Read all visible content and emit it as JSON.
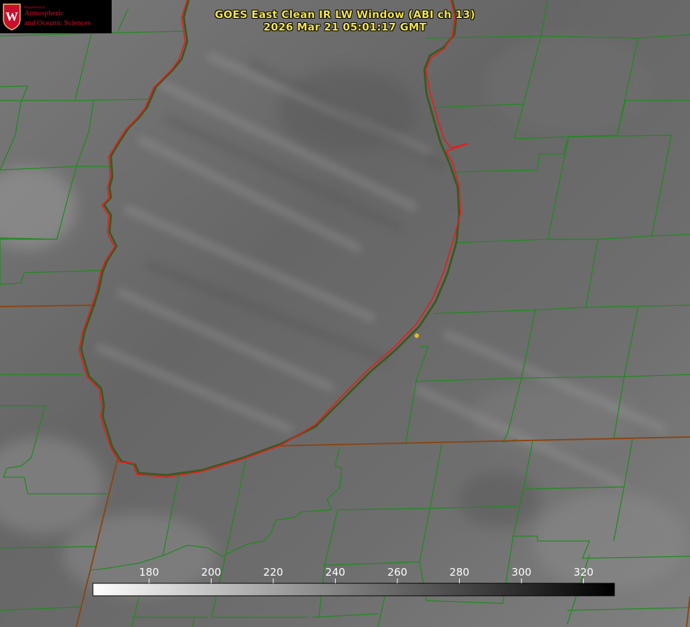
{
  "header": {
    "title_line1": "GOES East Clean IR LW Window (ABI ch 13)",
    "title_line2": "2026 Mar 21 05:01:17 GMT"
  },
  "logo": {
    "crest_letter": "W",
    "department": "Department of",
    "line1": "Atmospheric",
    "line2": "and Oceanic Sciences",
    "color": "#c8102e"
  },
  "colorbar": {
    "ticks": [
      "180",
      "200",
      "220",
      "240",
      "260",
      "280",
      "300",
      "320"
    ],
    "gradient_from": "#ffffff",
    "gradient_to": "#000000"
  },
  "map": {
    "boundary_color": "#1f8a1f",
    "lake_outline_color": "#e02020",
    "state_border_color": "#8b4513",
    "marker_color": "#d8c020"
  }
}
